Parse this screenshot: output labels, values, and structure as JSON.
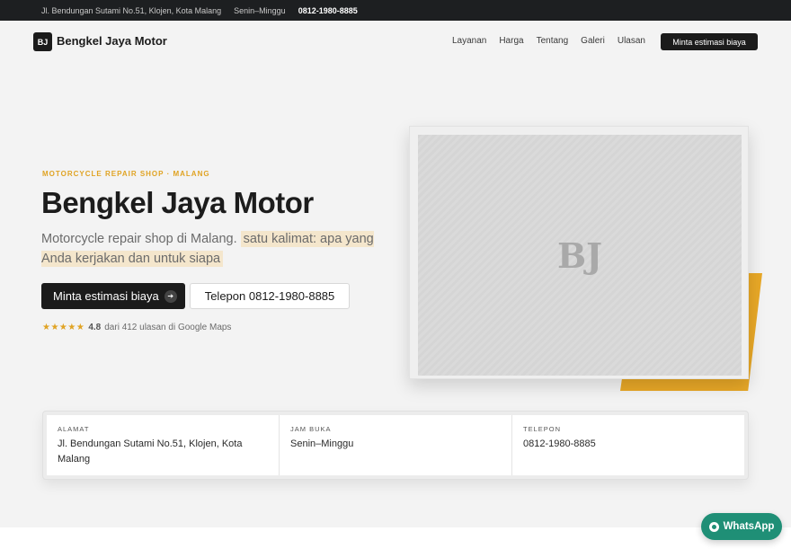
{
  "topbar": {
    "address": "Jl. Bendungan Sutami No.51, Klojen, Kota Malang",
    "hours": "Senin–Minggu",
    "phone": "0812-1980-8885"
  },
  "nav": {
    "logo": "BJ",
    "brand": "Bengkel Jaya Motor",
    "links": [
      "Layanan",
      "Harga",
      "Tentang",
      "Galeri",
      "Ulasan"
    ],
    "cta": "Minta estimasi biaya"
  },
  "hero": {
    "eyebrow": "MOTORCYCLE REPAIR SHOP · MALANG",
    "title": "Bengkel Jaya Motor",
    "lead_plain": "Motorcycle repair shop di Malang.",
    "lead_highlight": "satu kalimat: apa yang Anda kerjakan dan untuk siapa",
    "primary_cta": "Minta estimasi biaya",
    "secondary_cta": "Telepon 0812-1980-8885",
    "rating": {
      "stars": "★★★★★",
      "score": "4.8",
      "text": "dari 412 ulasan di Google Maps"
    },
    "image_placeholder": "BJ"
  },
  "info": [
    {
      "label": "ALAMAT",
      "value": "Jl. Bendungan Sutami No.51, Klojen, Kota Malang"
    },
    {
      "label": "JAM BUKA",
      "value": "Senin–Minggu"
    },
    {
      "label": "TELEPON",
      "value": "0812-1980-8885"
    }
  ],
  "whatsapp": {
    "label": "WhatsApp"
  },
  "colors": {
    "accent": "#e0a323",
    "dark": "#1b1b1b",
    "whatsapp": "#1f8f76"
  }
}
